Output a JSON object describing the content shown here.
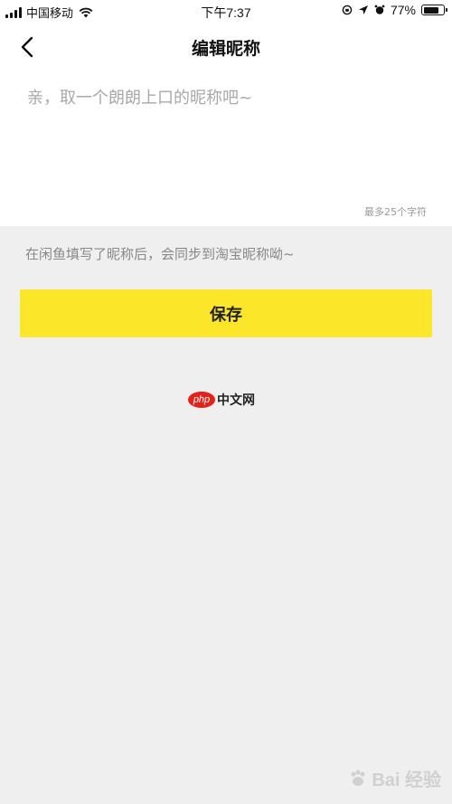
{
  "status_bar": {
    "carrier": "中国移动",
    "time": "下午7:37",
    "battery_percent": "77%",
    "battery_level": 0.77,
    "icons": [
      "signal-icon",
      "wifi-icon",
      "orientation-lock-icon",
      "location-icon",
      "alarm-icon",
      "battery-icon"
    ]
  },
  "nav": {
    "back_icon": "chevron-left-icon",
    "title": "编辑昵称"
  },
  "nickname": {
    "value": "",
    "placeholder": "亲，取一个朗朗上口的昵称吧~",
    "limit_text": "最多25个字符"
  },
  "hint": "在闲鱼填写了昵称后，会同步到淘宝昵称呦~",
  "save_label": "保存",
  "colors": {
    "accent": "#fce629",
    "background": "#efefef",
    "placeholder": "#a8a8a8"
  },
  "watermark": {
    "logo_text": "php",
    "site": "中文网"
  },
  "baidu_watermark": "Bai 经验"
}
